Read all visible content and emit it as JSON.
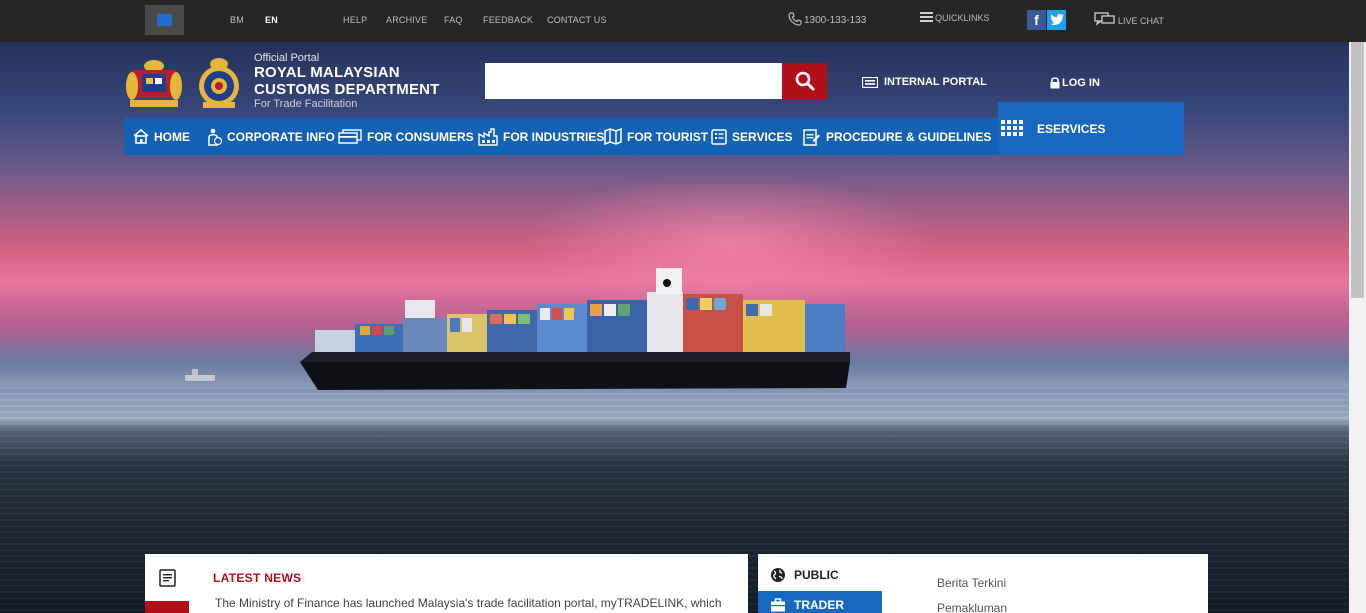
{
  "topbar": {
    "languages": [
      "BM",
      "EN"
    ],
    "active_language": "EN",
    "links": [
      "HELP",
      "ARCHIVE",
      "FAQ",
      "FEEDBACK",
      "CONTACT US"
    ],
    "phone": "1300-133-133",
    "quicklinks": "QUICKLINKS",
    "live_chat": "LIVE CHAT",
    "social": {
      "facebook": "f",
      "twitter": "twitter-icon"
    }
  },
  "header": {
    "official": "Official Portal",
    "title_line1": "ROYAL MALAYSIAN",
    "title_line2": "CUSTOMS DEPARTMENT",
    "tagline": "For Trade Facilitation",
    "search_placeholder": "",
    "internal_portal": "INTERNAL PORTAL",
    "login": "LOG IN"
  },
  "nav": {
    "items": [
      "HOME",
      "CORPORATE INFO",
      "FOR CONSUMERS",
      "FOR INDUSTRIES",
      "FOR TOURIST",
      "SERVICES",
      "PROCEDURE & GUIDELINES"
    ],
    "eservices": "ESERVICES"
  },
  "news": {
    "title": "LATEST NEWS",
    "text": "The Ministry of Finance has launched Malaysia's trade facilitation portal, myTRADELINK, which"
  },
  "audience": {
    "tabs": [
      "PUBLIC",
      "TRADER"
    ],
    "active_tab": "TRADER",
    "links": [
      "Berita Terkini",
      "Pemakluman"
    ]
  },
  "colors": {
    "nav_blue": "#1462b3",
    "brand_red": "#b30f1a",
    "topbar": "#262626"
  }
}
